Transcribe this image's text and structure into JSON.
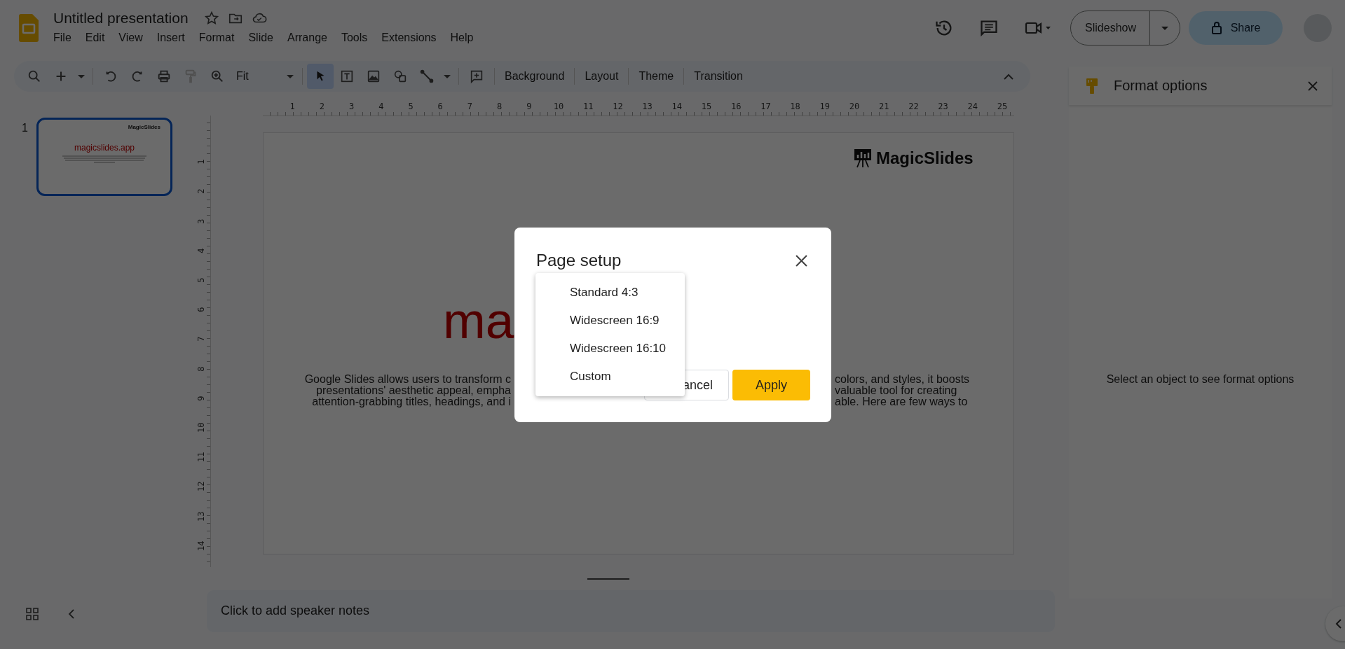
{
  "app": {
    "title": "Untitled presentation",
    "menu": [
      "File",
      "Edit",
      "View",
      "Insert",
      "Format",
      "Slide",
      "Arrange",
      "Tools",
      "Extensions",
      "Help"
    ]
  },
  "header_actions": {
    "slideshow": "Slideshow",
    "share": "Share"
  },
  "toolbar": {
    "zoom": "Fit",
    "tools": [
      {
        "kind": "search",
        "selected": false
      },
      {
        "kind": "add",
        "selected": false
      },
      {
        "kind": "caret",
        "selected": false
      },
      {
        "kind": "undo",
        "selected": false
      },
      {
        "kind": "redo",
        "selected": false
      },
      {
        "kind": "print",
        "selected": false
      },
      {
        "kind": "paint",
        "selected": false
      },
      {
        "kind": "zoom",
        "selected": false
      },
      {
        "kind": "zoomselect",
        "selected": false
      },
      {
        "kind": "select",
        "selected": true
      },
      {
        "kind": "textbox",
        "selected": false
      },
      {
        "kind": "image",
        "selected": false
      },
      {
        "kind": "shape",
        "selected": false
      },
      {
        "kind": "line",
        "selected": false
      },
      {
        "kind": "caret",
        "selected": false
      },
      {
        "kind": "comment",
        "selected": false
      }
    ],
    "buttons": [
      "Background",
      "Layout",
      "Theme",
      "Transition"
    ]
  },
  "filmstrip": [
    {
      "number": "1",
      "selected": true,
      "logo": "MagicSlides",
      "title": "magicslides.app"
    }
  ],
  "rulers": {
    "horizontal": [
      "1",
      "2",
      "3",
      "4",
      "5",
      "6",
      "7",
      "8",
      "9",
      "10",
      "11",
      "12",
      "13",
      "14",
      "15",
      "16",
      "17",
      "18",
      "19",
      "20",
      "21",
      "22",
      "23",
      "24",
      "25"
    ],
    "vertical": [
      "1",
      "2",
      "3",
      "4",
      "5",
      "6",
      "7",
      "8",
      "9",
      "10",
      "11",
      "12",
      "13",
      "14"
    ]
  },
  "slide": {
    "logo": "MagicSlides",
    "title_fragment": "ma",
    "body_left": [
      "Google Slides allows users to transform c",
      "presentations' aesthetic appeal, empha",
      "attention-grabbing titles, headings, and i"
    ],
    "body_right": [
      "colors, and styles, it boosts",
      "valuable tool for creating",
      "able. Here are few ways to"
    ]
  },
  "notes": {
    "placeholder": "Click to add speaker notes"
  },
  "format_panel": {
    "title": "Format options",
    "hint": "Select an object to see format options"
  },
  "dialog": {
    "title": "Page setup",
    "cancel": "ancel",
    "apply": "Apply",
    "options": [
      "Standard 4:3",
      "Widescreen 16:9",
      "Widescreen 16:10",
      "Custom"
    ]
  }
}
